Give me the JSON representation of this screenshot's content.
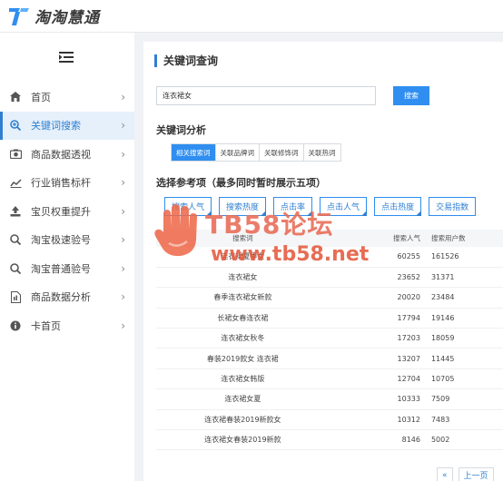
{
  "app": {
    "title": "淘淘慧通"
  },
  "sidebar": {
    "items": [
      {
        "label": "首页",
        "icon": "home-icon"
      },
      {
        "label": "关键词搜索",
        "icon": "search-plus-icon",
        "active": true
      },
      {
        "label": "商品数据透视",
        "icon": "camera-icon"
      },
      {
        "label": "行业销售标杆",
        "icon": "line-chart-icon"
      },
      {
        "label": "宝贝权重提升",
        "icon": "upload-icon"
      },
      {
        "label": "淘宝极速验号",
        "icon": "search-icon"
      },
      {
        "label": "淘宝普通验号",
        "icon": "search-icon"
      },
      {
        "label": "商品数据分析",
        "icon": "document-icon"
      },
      {
        "label": "卡首页",
        "icon": "info-icon"
      }
    ]
  },
  "main": {
    "title": "关键词查询",
    "search": {
      "value": "连衣裙女",
      "button": "搜索"
    },
    "analysis_title": "关键词分析",
    "tabs": [
      "相关搜索词",
      "关联品牌词",
      "关联修饰词",
      "关联热词"
    ],
    "reference_title": "选择参考项（最多同时暂时展示五项）",
    "filters": [
      "搜索人气",
      "搜索热度",
      "点击率",
      "点击人气",
      "点击热度",
      "交易指数"
    ],
    "table": {
      "headers": [
        "搜索词",
        "搜索人气",
        "搜索用户数"
      ],
      "rows": [
        [
          "连衣裙夏季女",
          "60255",
          "161526"
        ],
        [
          "连衣裙女",
          "23652",
          "31371"
        ],
        [
          "春季连衣裙女新款",
          "20020",
          "23484"
        ],
        [
          "长裙女春连衣裙",
          "17794",
          "19146"
        ],
        [
          "连衣裙女秋冬",
          "17203",
          "18059"
        ],
        [
          "春装2019款女 连衣裙",
          "13207",
          "11445"
        ],
        [
          "连衣裙女韩版",
          "12704",
          "10705"
        ],
        [
          "连衣裙女夏",
          "10333",
          "7509"
        ],
        [
          "连衣裙春装2019新款女",
          "10312",
          "7483"
        ],
        [
          "连衣裙女春装2019新款",
          "8146",
          "5002"
        ]
      ]
    },
    "pager": {
      "prev_icon": "«",
      "prev": "上一页"
    }
  },
  "watermark": {
    "line1": "TB58论坛",
    "line2": "www.tb58.net"
  },
  "colors": {
    "accent": "#2f8ef0",
    "highlight": "#e53935",
    "active_bg": "#e6f0fb"
  }
}
